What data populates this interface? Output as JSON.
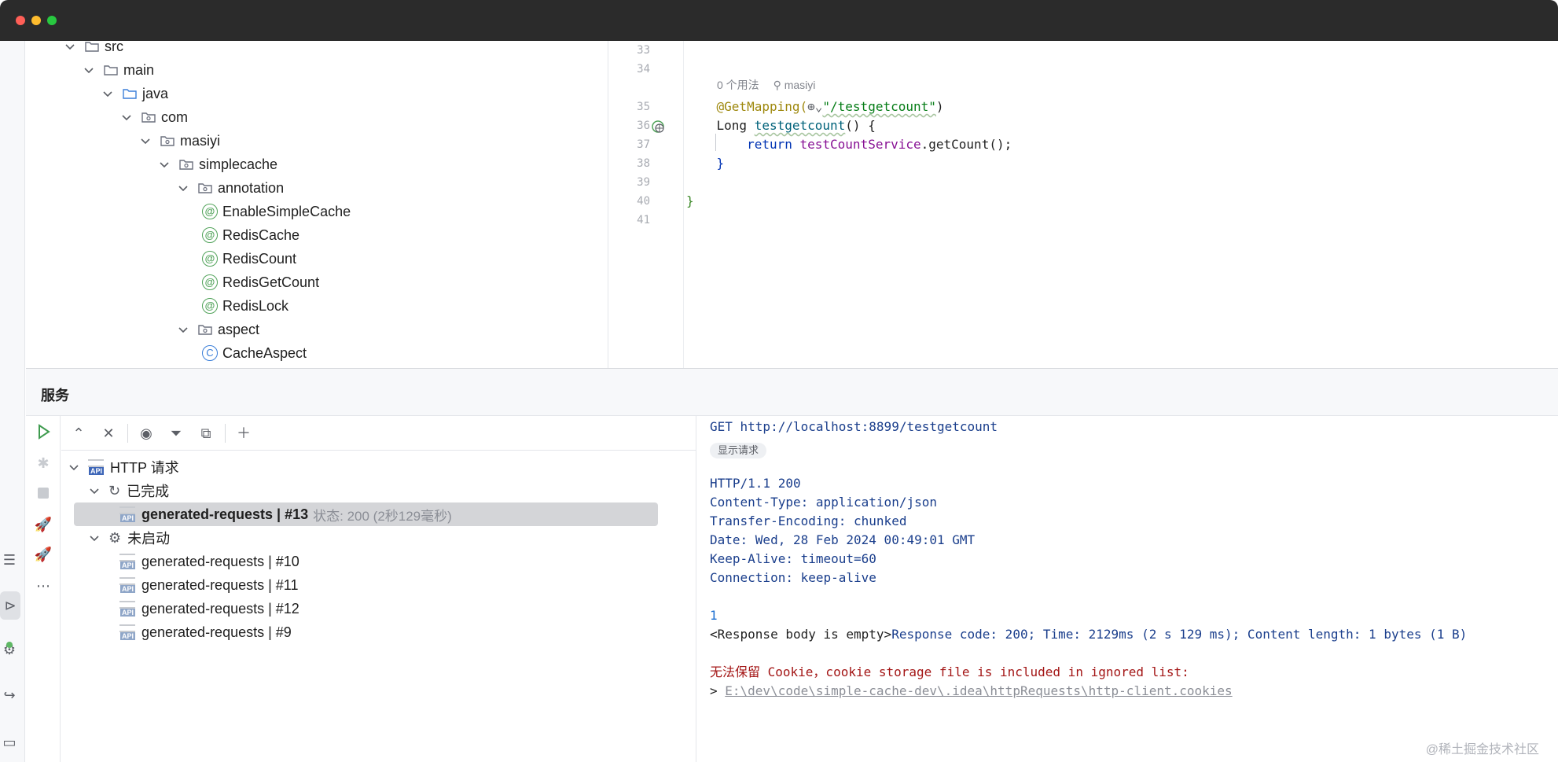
{
  "window": {
    "traffic_lights": [
      "#ff5f57",
      "#febc2e",
      "#28c840"
    ]
  },
  "project_tree": {
    "items": [
      {
        "label": "src",
        "kind": "folder"
      },
      {
        "label": "main",
        "kind": "folder"
      },
      {
        "label": "java",
        "kind": "source-folder"
      },
      {
        "label": "com",
        "kind": "package"
      },
      {
        "label": "masiyi",
        "kind": "package"
      },
      {
        "label": "simplecache",
        "kind": "package"
      },
      {
        "label": "annotation",
        "kind": "package"
      },
      {
        "label": "EnableSimpleCache",
        "kind": "annotation"
      },
      {
        "label": "RedisCache",
        "kind": "annotation"
      },
      {
        "label": "RedisCount",
        "kind": "annotation"
      },
      {
        "label": "RedisGetCount",
        "kind": "annotation"
      },
      {
        "label": "RedisLock",
        "kind": "annotation"
      },
      {
        "label": "aspect",
        "kind": "package"
      },
      {
        "label": "CacheAspect",
        "kind": "class"
      }
    ]
  },
  "editor": {
    "line_numbers": [
      "33",
      "34",
      "35",
      "36",
      "37",
      "38",
      "39",
      "40",
      "41"
    ],
    "inlay_hint": {
      "usages": "0 个用法",
      "author": "masiyi"
    },
    "code": {
      "l35_annotation": "@GetMapping(",
      "l35_string": "\"/testgetcount\"",
      "l35_close": ")",
      "l36_type": "Long ",
      "l36_method": "testgetcount",
      "l36_rest": "() {",
      "l37_keyword": "return ",
      "l37_field": "testCountService",
      "l37_rest": ".getCount();",
      "l38": "}",
      "l40": "}"
    }
  },
  "services": {
    "title": "服务",
    "tree": {
      "root": "HTTP 请求",
      "completed_group": "已完成",
      "selected": {
        "name": "generated-requests  |  #13",
        "status": "状态: 200 (2秒129毫秒)"
      },
      "not_started_group": "未启动",
      "pending": [
        "generated-requests  |  #10",
        "generated-requests  |  #11",
        "generated-requests  |  #12",
        "generated-requests  |  #9"
      ]
    },
    "response": {
      "request_line": "GET http://localhost:8899/testgetcount",
      "show_request": "显示请求",
      "status_line": "HTTP/1.1 200",
      "headers": [
        "Content-Type: application/json",
        "Transfer-Encoding: chunked",
        "Date: Wed, 28 Feb 2024 00:49:01 GMT",
        "Keep-Alive: timeout=60",
        "Connection: keep-alive"
      ],
      "body": "1",
      "empty_prefix": "<Response body is empty>",
      "summary": "Response code: 200; Time: 2129ms (2 s 129 ms); Content length: 1 bytes (1 B)",
      "cookie_warning": "无法保留 Cookie，cookie storage file is included in ignored list:",
      "cookie_prefix": "> ",
      "cookie_path": "E:\\dev\\code\\simple-cache-dev\\.idea\\httpRequests\\http-client.cookies"
    }
  },
  "watermark": "@稀土掘金技术社区",
  "colors": {
    "titlebar": "#2b2b2b",
    "selection": "#d4d5d8",
    "annotation": "#9e880d",
    "string": "#067d17",
    "keyword": "#0033b3",
    "error_text": "#a31515"
  }
}
